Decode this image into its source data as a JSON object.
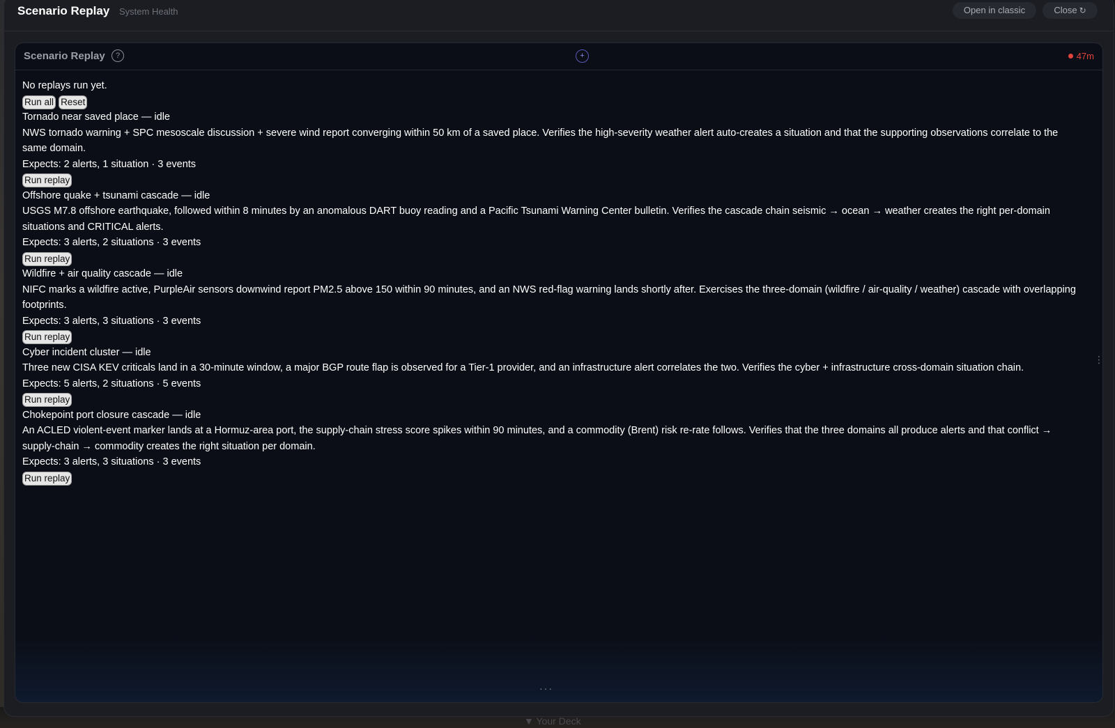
{
  "window": {
    "title": "Scenario Replay",
    "subtitle": "System Health",
    "open_classic_label": "Open in classic",
    "close_label": "Close",
    "background_label": "▼ Your Deck"
  },
  "panel": {
    "title": "Scenario Replay",
    "help_glyph": "?",
    "add_glyph": "+",
    "status_text": "47m",
    "status_color": "#e0443c"
  },
  "summary": {
    "no_runs_text": "No replays run yet.",
    "run_all_label": "Run all",
    "reset_label": "Reset"
  },
  "scenarios": [
    {
      "title": "Tornado near saved place — idle",
      "description": "NWS tornado warning + SPC mesoscale discussion + severe wind report converging within 50 km of a saved place. Verifies the high-severity weather alert auto-creates a situation and that the supporting observations correlate to the same domain.",
      "expects": "Expects: 2 alerts, 1 situation · 3 events",
      "button_label": "Run replay"
    },
    {
      "title": "Offshore quake + tsunami cascade — idle",
      "description": "USGS M7.8 offshore earthquake, followed within 8 minutes by an anomalous DART buoy reading and a Pacific Tsunami Warning Center bulletin. Verifies the cascade chain seismic → ocean → weather creates the right per-domain situations and CRITICAL alerts.",
      "expects": "Expects: 3 alerts, 2 situations · 3 events",
      "button_label": "Run replay"
    },
    {
      "title": "Wildfire + air quality cascade — idle",
      "description": "NIFC marks a wildfire active, PurpleAir sensors downwind report PM2.5 above 150 within 90 minutes, and an NWS red-flag warning lands shortly after. Exercises the three-domain (wildfire / air-quality / weather) cascade with overlapping footprints.",
      "expects": "Expects: 3 alerts, 3 situations · 3 events",
      "button_label": "Run replay"
    },
    {
      "title": "Cyber incident cluster — idle",
      "description": "Three new CISA KEV criticals land in a 30-minute window, a major BGP route flap is observed for a Tier-1 provider, and an infrastructure alert correlates the two. Verifies the cyber + infrastructure cross-domain situation chain.",
      "expects": "Expects: 5 alerts, 2 situations · 5 events",
      "button_label": "Run replay"
    },
    {
      "title": "Chokepoint port closure cascade — idle",
      "description": "An ACLED violent-event marker lands at a Hormuz-area port, the supply-chain stress score spikes within 90 minutes, and a commodity (Brent) risk re-rate follows. Verifies that the three domains all produce alerts and that conflict → supply-chain → commodity creates the right situation per domain.",
      "expects": "Expects: 3 alerts, 3 situations · 3 events",
      "button_label": "Run replay"
    }
  ],
  "icons": {
    "kebab": "⋮",
    "more": "···",
    "close": "↻"
  }
}
